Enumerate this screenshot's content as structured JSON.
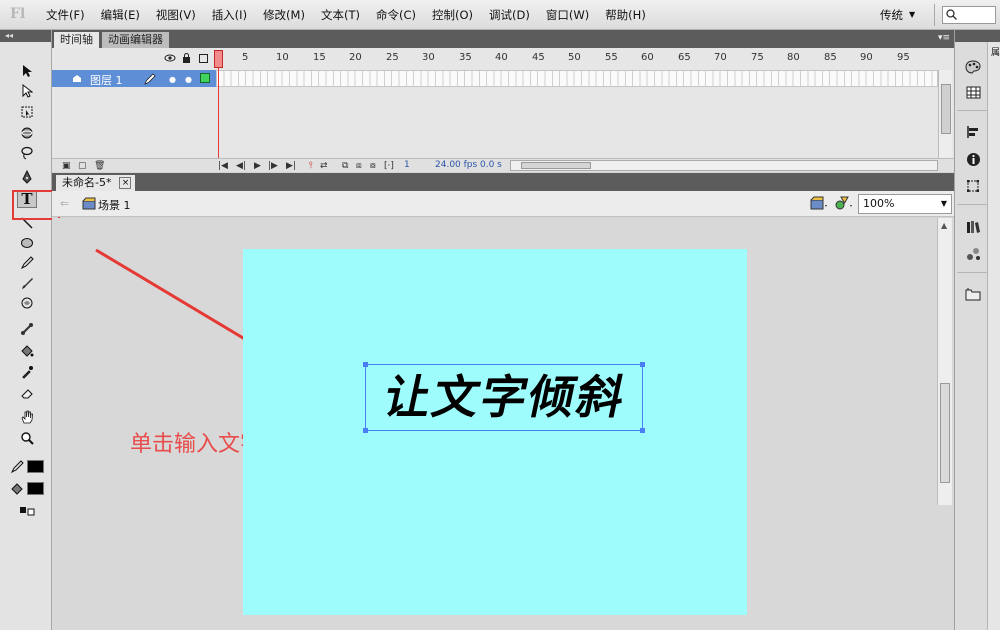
{
  "app": {
    "logo": "Fl"
  },
  "menu": {
    "items": [
      "文件(F)",
      "编辑(E)",
      "视图(V)",
      "插入(I)",
      "修改(M)",
      "文本(T)",
      "命令(C)",
      "控制(O)",
      "调试(D)",
      "窗口(W)",
      "帮助(H)"
    ],
    "workspace": "传统",
    "workspace_arrow": "▼"
  },
  "timeline": {
    "tabs": [
      "时间轴",
      "动画编辑器"
    ],
    "ruler": [
      "1",
      "5",
      "10",
      "15",
      "20",
      "25",
      "30",
      "35",
      "40",
      "45",
      "50",
      "55",
      "60",
      "65",
      "70",
      "75",
      "80",
      "85",
      "90",
      "95"
    ],
    "layer_name": "图层 1",
    "current_frame": "1",
    "fps": "24.00 fps",
    "time": "0.0 s"
  },
  "document": {
    "tab_title": "未命名-5*",
    "close": "×"
  },
  "scene": {
    "label": "场景 1",
    "zoom": "100%",
    "zoom_arrow": "▼",
    "back_arrow": "⇐"
  },
  "stage": {
    "text": "让文字倾斜",
    "background": "#9ffcfd"
  },
  "annotation": {
    "text": "单击输入文字",
    "color": "#e84c4c"
  },
  "toolbox": {
    "header": "◂◂",
    "selected_tool": "text-tool",
    "text_tool_glyph": "T"
  },
  "dock": {
    "strip_label": "属"
  }
}
